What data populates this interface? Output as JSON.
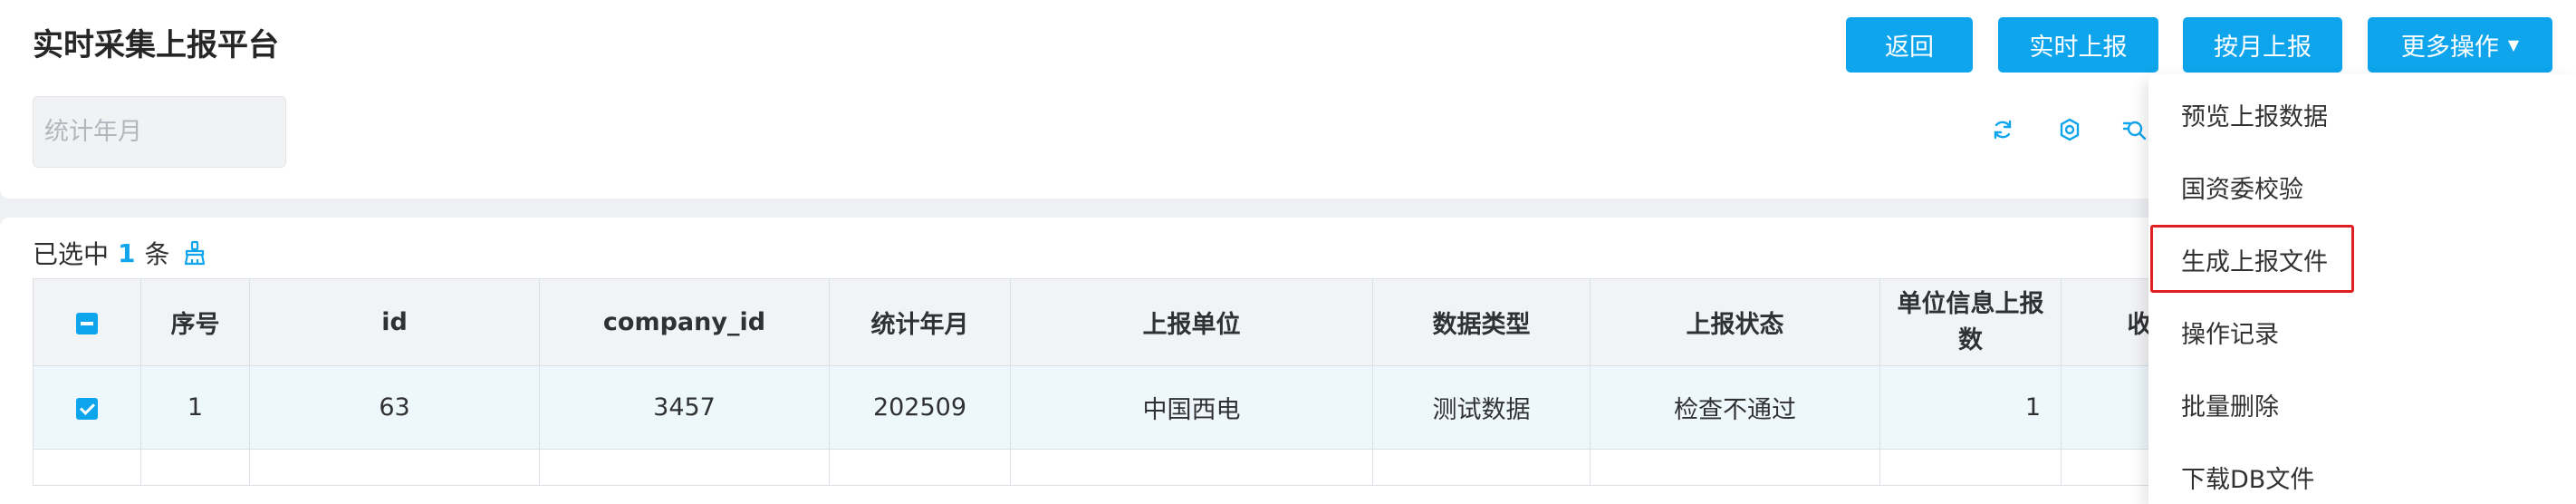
{
  "page": {
    "title": "实时采集上报平台"
  },
  "toolbar": {
    "back": "返回",
    "realtime_report": "实时上报",
    "monthly_report": "按月上报",
    "more_actions": "更多操作"
  },
  "filter": {
    "month_placeholder": "统计年月"
  },
  "icons": {
    "refresh": "refresh-icon",
    "settings": "gear-icon",
    "search": "search-icon",
    "clear": "brush-icon"
  },
  "selection": {
    "prefix": "已选中",
    "count": "1",
    "suffix": "条"
  },
  "table": {
    "headers": {
      "index": "序号",
      "id": "id",
      "company_id": "company_id",
      "stat_month": "统计年月",
      "report_unit": "上报单位",
      "data_type": "数据类型",
      "report_status": "上报状态",
      "unit_info_count": "单位信息上报数",
      "income": "收入"
    },
    "rows": [
      {
        "index": "1",
        "id": "63",
        "company_id": "3457",
        "stat_month": "202509",
        "report_unit": "中国西电",
        "data_type": "测试数据",
        "report_status": "检查不通过",
        "unit_info_count": "1",
        "income": ""
      }
    ]
  },
  "dropdown": {
    "items": [
      "预览上报数据",
      "国资委校验",
      "生成上报文件",
      "操作记录",
      "批量删除",
      "下载DB文件"
    ],
    "highlighted": "生成上报文件"
  },
  "colors": {
    "primary": "#0ea5ec",
    "highlight_border": "#e02020",
    "row_selected": "#eef7fc",
    "header_bg": "#f2f3f5"
  }
}
